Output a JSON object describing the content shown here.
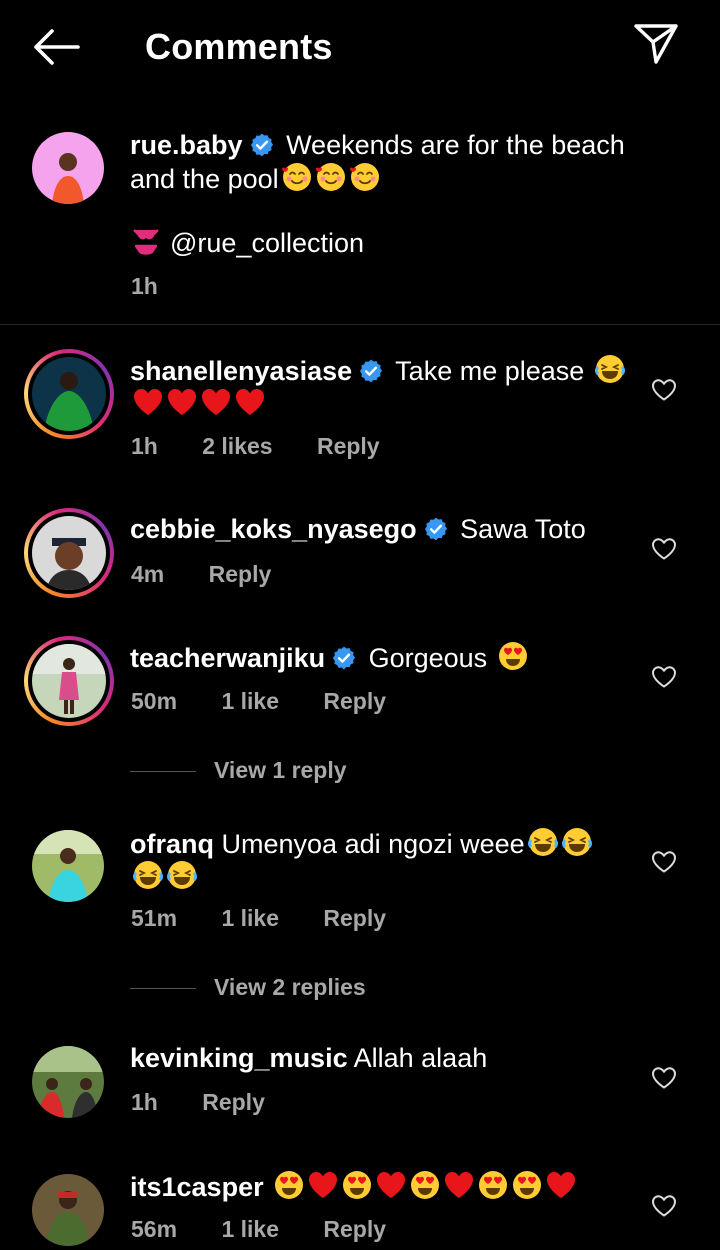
{
  "header": {
    "title": "Comments"
  },
  "caption": {
    "username": "rue.baby",
    "text_line1": "Weekends are for the beach",
    "text_line2": "and the pool",
    "mention": "@rue_collection",
    "time": "1h"
  },
  "comments": [
    {
      "username": "shanellenyasiase",
      "text": "Take me please",
      "time": "1h",
      "likes": "2 likes",
      "reply": "Reply"
    },
    {
      "username": "cebbie_koks_nyasego",
      "text": "Sawa Toto",
      "time": "4m",
      "reply": "Reply"
    },
    {
      "username": "teacherwanjiku",
      "text": "Gorgeous",
      "time": "50m",
      "likes": "1 like",
      "reply": "Reply",
      "view_replies": "View 1 reply"
    },
    {
      "username": "ofranq",
      "text": "Umenyoa adi ngozi weee",
      "time": "51m",
      "likes": "1 like",
      "reply": "Reply",
      "view_replies": "View 2 replies"
    },
    {
      "username": "kevinking_music",
      "text": "Allah alaah",
      "time": "1h",
      "reply": "Reply"
    },
    {
      "username": "its1casper",
      "time": "56m",
      "likes": "1 like",
      "reply": "Reply"
    }
  ],
  "icons": {
    "back": "arrow-left-icon",
    "send": "paper-plane-icon",
    "like": "heart-outline-icon",
    "verified": "verified-badge-icon"
  },
  "colors": {
    "background": "#000000",
    "secondary_text": "#a8a8a8",
    "verified": "#3897f0",
    "heart": "#e8151a"
  }
}
